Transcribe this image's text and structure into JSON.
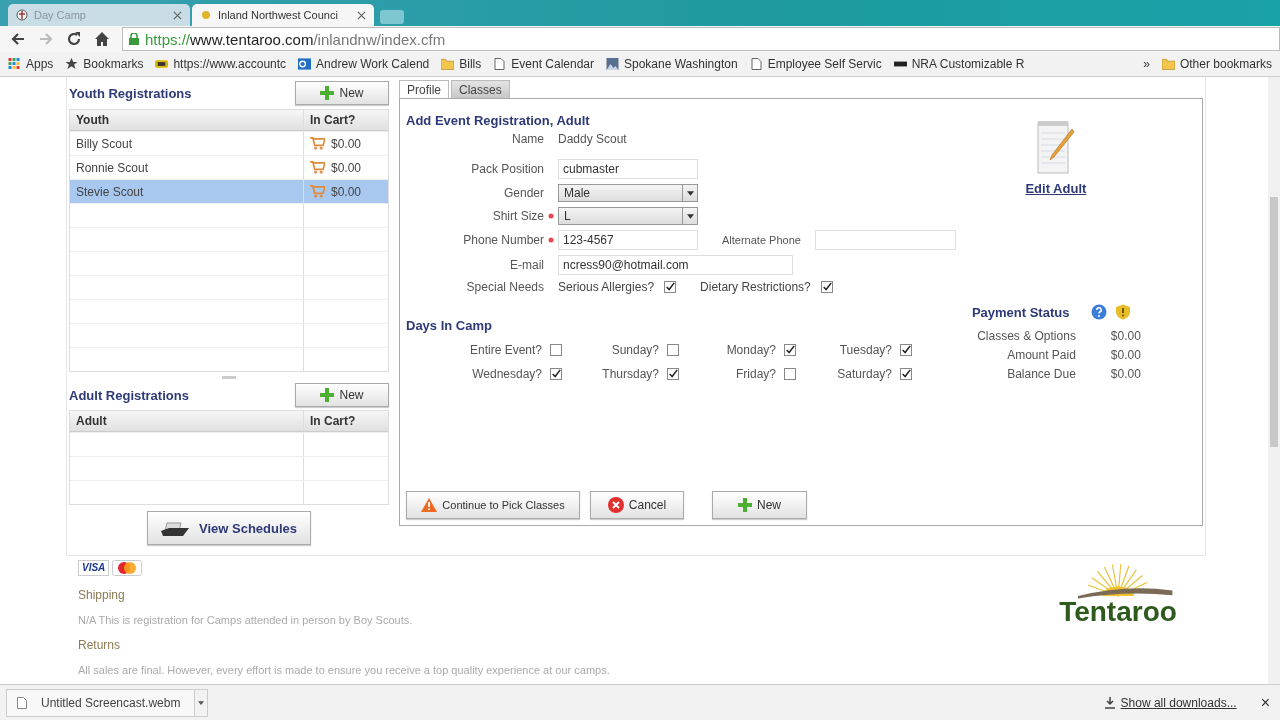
{
  "browser": {
    "tabs": [
      {
        "title": "Day Camp",
        "selected": false
      },
      {
        "title": "Inland Northwest Counci",
        "selected": true
      }
    ],
    "url": {
      "scheme": "https://",
      "host": "www.tentaroo.com",
      "path": "/inlandnw/index.cfm"
    },
    "bookmarks": [
      {
        "label": "Apps",
        "kind": "apps"
      },
      {
        "label": "Bookmarks",
        "kind": "star"
      },
      {
        "label": "https://www.accountc",
        "kind": "site"
      },
      {
        "label": "Andrew Work Calend",
        "kind": "outlook"
      },
      {
        "label": "Bills",
        "kind": "folder"
      },
      {
        "label": "Event Calendar",
        "kind": "page"
      },
      {
        "label": "Spokane Washington",
        "kind": "photo"
      },
      {
        "label": "Employee Self Servic",
        "kind": "page"
      },
      {
        "label": "NRA Customizable R",
        "kind": "nra"
      }
    ],
    "overflow": "»",
    "other_bookmarks": "Other bookmarks"
  },
  "youth": {
    "title": "Youth Registrations",
    "new_button": "New",
    "columns": [
      "Youth",
      "In Cart?"
    ],
    "rows": [
      {
        "name": "Billy Scout",
        "amount": "$0.00",
        "selected": false
      },
      {
        "name": "Ronnie Scout",
        "amount": "$0.00",
        "selected": false
      },
      {
        "name": "Stevie Scout",
        "amount": "$0.00",
        "selected": true
      }
    ]
  },
  "adult": {
    "title": "Adult Registrations",
    "new_button": "New",
    "columns": [
      "Adult",
      "In Cart?"
    ]
  },
  "view_schedules_button": "View Schedules",
  "panel_tabs": [
    {
      "label": "Profile",
      "selected": true
    },
    {
      "label": "Classes",
      "selected": false
    }
  ],
  "form": {
    "heading": "Add Event Registration, Adult",
    "name_label": "Name",
    "name_value": "Daddy Scout",
    "pack_position": {
      "label": "Pack Position",
      "value": "cubmaster"
    },
    "gender": {
      "label": "Gender",
      "value": "Male"
    },
    "shirt_size": {
      "label": "Shirt Size",
      "value": "L",
      "required": true
    },
    "phone": {
      "label": "Phone Number",
      "value": "123-4567",
      "required": true
    },
    "alternate_phone": {
      "label": "Alternate Phone"
    },
    "email": {
      "label": "E-mail",
      "value": "ncress90@hotmail.com"
    },
    "special_needs": {
      "label": "Special Needs",
      "options": [
        {
          "label": "Serious Allergies?",
          "checked": true
        },
        {
          "label": "Dietary Restrictions?",
          "checked": true
        }
      ]
    }
  },
  "edit_link": "Edit Adult",
  "days": {
    "title": "Days In Camp",
    "items": [
      {
        "label": "Entire Event?",
        "checked": false
      },
      {
        "label": "Sunday?",
        "checked": false
      },
      {
        "label": "Monday?",
        "checked": true
      },
      {
        "label": "Tuesday?",
        "checked": true
      },
      {
        "label": "Wednesday?",
        "checked": true
      },
      {
        "label": "Thursday?",
        "checked": true
      },
      {
        "label": "Friday?",
        "checked": false
      },
      {
        "label": "Saturday?",
        "checked": true
      }
    ]
  },
  "payment": {
    "title": "Payment Status",
    "lines": [
      {
        "label": "Classes & Options",
        "amount": "$0.00"
      },
      {
        "label": "Amount Paid",
        "amount": "$0.00"
      },
      {
        "label": "Balance Due",
        "amount": "$0.00"
      }
    ]
  },
  "buttons": [
    {
      "label": "Continue to Pick Classes",
      "kind": "warning"
    },
    {
      "label": "Cancel",
      "kind": "cancel"
    },
    {
      "label": "New",
      "kind": "add"
    }
  ],
  "footer": {
    "card_logos": [
      "VISA"
    ],
    "shipping_title": "Shipping",
    "shipping_text": "N/A This is registration for Camps attended in person by Boy Scouts.",
    "returns_title": "Returns",
    "returns_text": "All sales are final. However, every effort is made to ensure you receive a top quality experience at our camps.",
    "logo": "Tentaroo"
  },
  "downloads": {
    "file": "Untitled Screencast.webm",
    "show_all": "Show all downloads...",
    "close": "×"
  }
}
